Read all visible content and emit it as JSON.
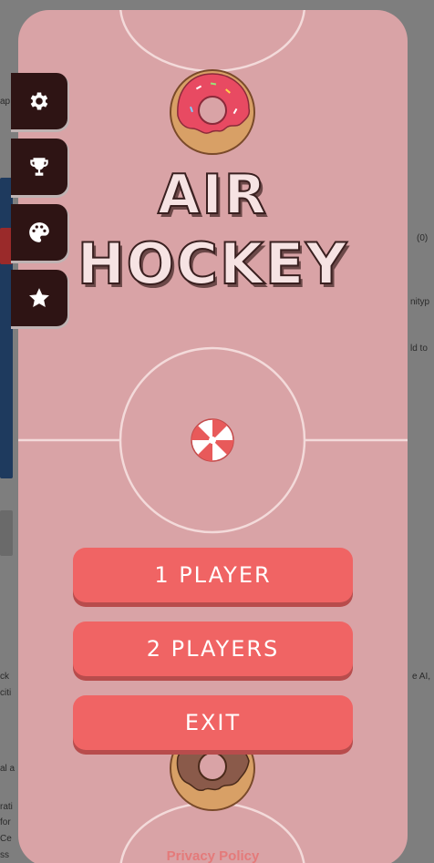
{
  "background_fragments": [
    "ap",
    "(0)",
    "nityp",
    "ld to",
    "ck",
    "e AI,",
    "citi",
    "al a",
    "rati",
    "for",
    "Ce",
    "ss"
  ],
  "sidebar": {
    "items": [
      {
        "name": "settings",
        "icon": "gear-icon"
      },
      {
        "name": "achievements",
        "icon": "trophy-icon"
      },
      {
        "name": "themes",
        "icon": "palette-icon"
      },
      {
        "name": "rate",
        "icon": "star-icon"
      }
    ]
  },
  "title": {
    "line1": "AIR",
    "line2": "HOCKEY"
  },
  "menu": {
    "one_player": "1 PLAYER",
    "two_players": "2 PLAYERS",
    "exit": "EXIT"
  },
  "footer": {
    "privacy_policy": "Privacy Policy"
  },
  "colors": {
    "board": "#d9a3a6",
    "button": "#f06464",
    "sidebar": "#2e1414",
    "donut_top_icing": "#e84a62",
    "donut_bottom_icing": "#8a5a4a",
    "puck": "#e85a5a"
  }
}
